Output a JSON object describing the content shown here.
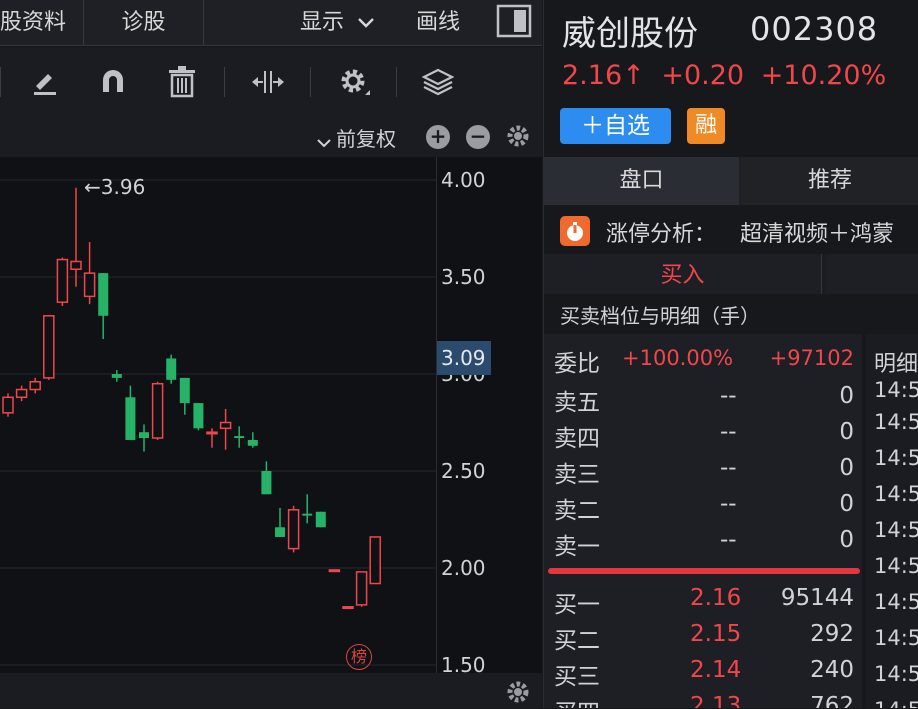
{
  "top_tabs": {
    "profile": "股资料",
    "diagnose": "诊股",
    "display": "显示",
    "draw": "画线"
  },
  "chart_header": {
    "adjust_mode": "前复权"
  },
  "chart": {
    "high_annotation": "←3.96",
    "current_price_tag": "3.09",
    "y_ticks": [
      "4.00",
      "3.50",
      "3.00",
      "2.50",
      "2.00",
      "1.50"
    ],
    "rank_badge": "榜",
    "colors": {
      "up": "#f0474a",
      "down": "#26b368"
    }
  },
  "chart_data": {
    "type": "candlestick",
    "ylim": [
      1.5,
      4.0
    ],
    "y_ticks": [
      4.0,
      3.5,
      3.0,
      2.5,
      2.0,
      1.5
    ],
    "candles": [
      {
        "o": 2.8,
        "c": 2.88,
        "h": 2.9,
        "l": 2.78
      },
      {
        "o": 2.88,
        "c": 2.92,
        "h": 2.94,
        "l": 2.86
      },
      {
        "o": 2.92,
        "c": 2.96,
        "h": 2.98,
        "l": 2.9
      },
      {
        "o": 2.98,
        "c": 3.3,
        "h": 3.3,
        "l": 2.97
      },
      {
        "o": 3.37,
        "c": 3.59,
        "h": 3.6,
        "l": 3.35
      },
      {
        "o": 3.54,
        "c": 3.58,
        "h": 3.96,
        "l": 3.45
      },
      {
        "o": 3.4,
        "c": 3.52,
        "h": 3.68,
        "l": 3.36
      },
      {
        "o": 3.52,
        "c": 3.3,
        "h": 3.52,
        "l": 3.18
      },
      {
        "o": 3.0,
        "c": 2.98,
        "h": 3.02,
        "l": 2.96
      },
      {
        "o": 2.88,
        "c": 2.66,
        "h": 2.94,
        "l": 2.66
      },
      {
        "o": 2.7,
        "c": 2.67,
        "h": 2.74,
        "l": 2.6
      },
      {
        "o": 2.67,
        "c": 2.95,
        "h": 2.96,
        "l": 2.66
      },
      {
        "o": 3.08,
        "c": 2.97,
        "h": 3.1,
        "l": 2.95
      },
      {
        "o": 2.98,
        "c": 2.85,
        "h": 2.98,
        "l": 2.79
      },
      {
        "o": 2.85,
        "c": 2.72,
        "h": 2.85,
        "l": 2.71
      },
      {
        "o": 2.7,
        "c": 2.7,
        "h": 2.72,
        "l": 2.62
      },
      {
        "o": 2.72,
        "c": 2.75,
        "h": 2.82,
        "l": 2.61
      },
      {
        "o": 2.68,
        "c": 2.67,
        "h": 2.73,
        "l": 2.62
      },
      {
        "o": 2.66,
        "c": 2.63,
        "h": 2.7,
        "l": 2.62
      },
      {
        "o": 2.5,
        "c": 2.38,
        "h": 2.55,
        "l": 2.38
      },
      {
        "o": 2.21,
        "c": 2.16,
        "h": 2.31,
        "l": 2.16
      },
      {
        "o": 2.1,
        "c": 2.3,
        "h": 2.32,
        "l": 2.08
      },
      {
        "o": 2.28,
        "c": 2.27,
        "h": 2.38,
        "l": 2.23
      },
      {
        "o": 2.29,
        "c": 2.21,
        "h": 2.29,
        "l": 2.21
      },
      {
        "o": 1.99,
        "c": 1.99,
        "h": 1.99,
        "l": 1.99
      },
      {
        "o": 1.8,
        "c": 1.8,
        "h": 1.8,
        "l": 1.8
      },
      {
        "o": 1.81,
        "c": 1.98,
        "h": 1.98,
        "l": 1.8
      },
      {
        "o": 1.92,
        "c": 2.16,
        "h": 2.16,
        "l": 1.92
      }
    ]
  },
  "stock": {
    "name": "威创股份",
    "code": "002308",
    "price": "2.16↑",
    "change": "+0.20",
    "pct": "+10.20%"
  },
  "buttons": {
    "add_watch": "＋自选",
    "margin_badge": "融"
  },
  "subtabs": [
    "盘口",
    "推荐"
  ],
  "limit_up": {
    "label": "涨停分析：",
    "text": "超清视频＋鸿蒙"
  },
  "trade_tabs": {
    "buy": "买入"
  },
  "orderbook": {
    "title": "买卖档位与明细（手）",
    "ratio_label": "委比",
    "ratio_pct": "+100.00%",
    "ratio_value": "+97102",
    "detail_label": "明细",
    "asks": [
      {
        "label": "卖五",
        "price": "--",
        "vol": "0"
      },
      {
        "label": "卖四",
        "price": "--",
        "vol": "0"
      },
      {
        "label": "卖三",
        "price": "--",
        "vol": "0"
      },
      {
        "label": "卖二",
        "price": "--",
        "vol": "0"
      },
      {
        "label": "卖一",
        "price": "--",
        "vol": "0"
      }
    ],
    "bids": [
      {
        "label": "买一",
        "price": "2.16",
        "vol": "95144"
      },
      {
        "label": "买二",
        "price": "2.15",
        "vol": "292"
      },
      {
        "label": "买三",
        "price": "2.14",
        "vol": "240"
      },
      {
        "label": "买四",
        "price": "2.13",
        "vol": "762"
      }
    ],
    "times": [
      "14:5",
      "14:5",
      "14:5",
      "14:5",
      "14:5",
      "14:5",
      "14:5",
      "14:5",
      "14:5",
      "14:5"
    ]
  }
}
